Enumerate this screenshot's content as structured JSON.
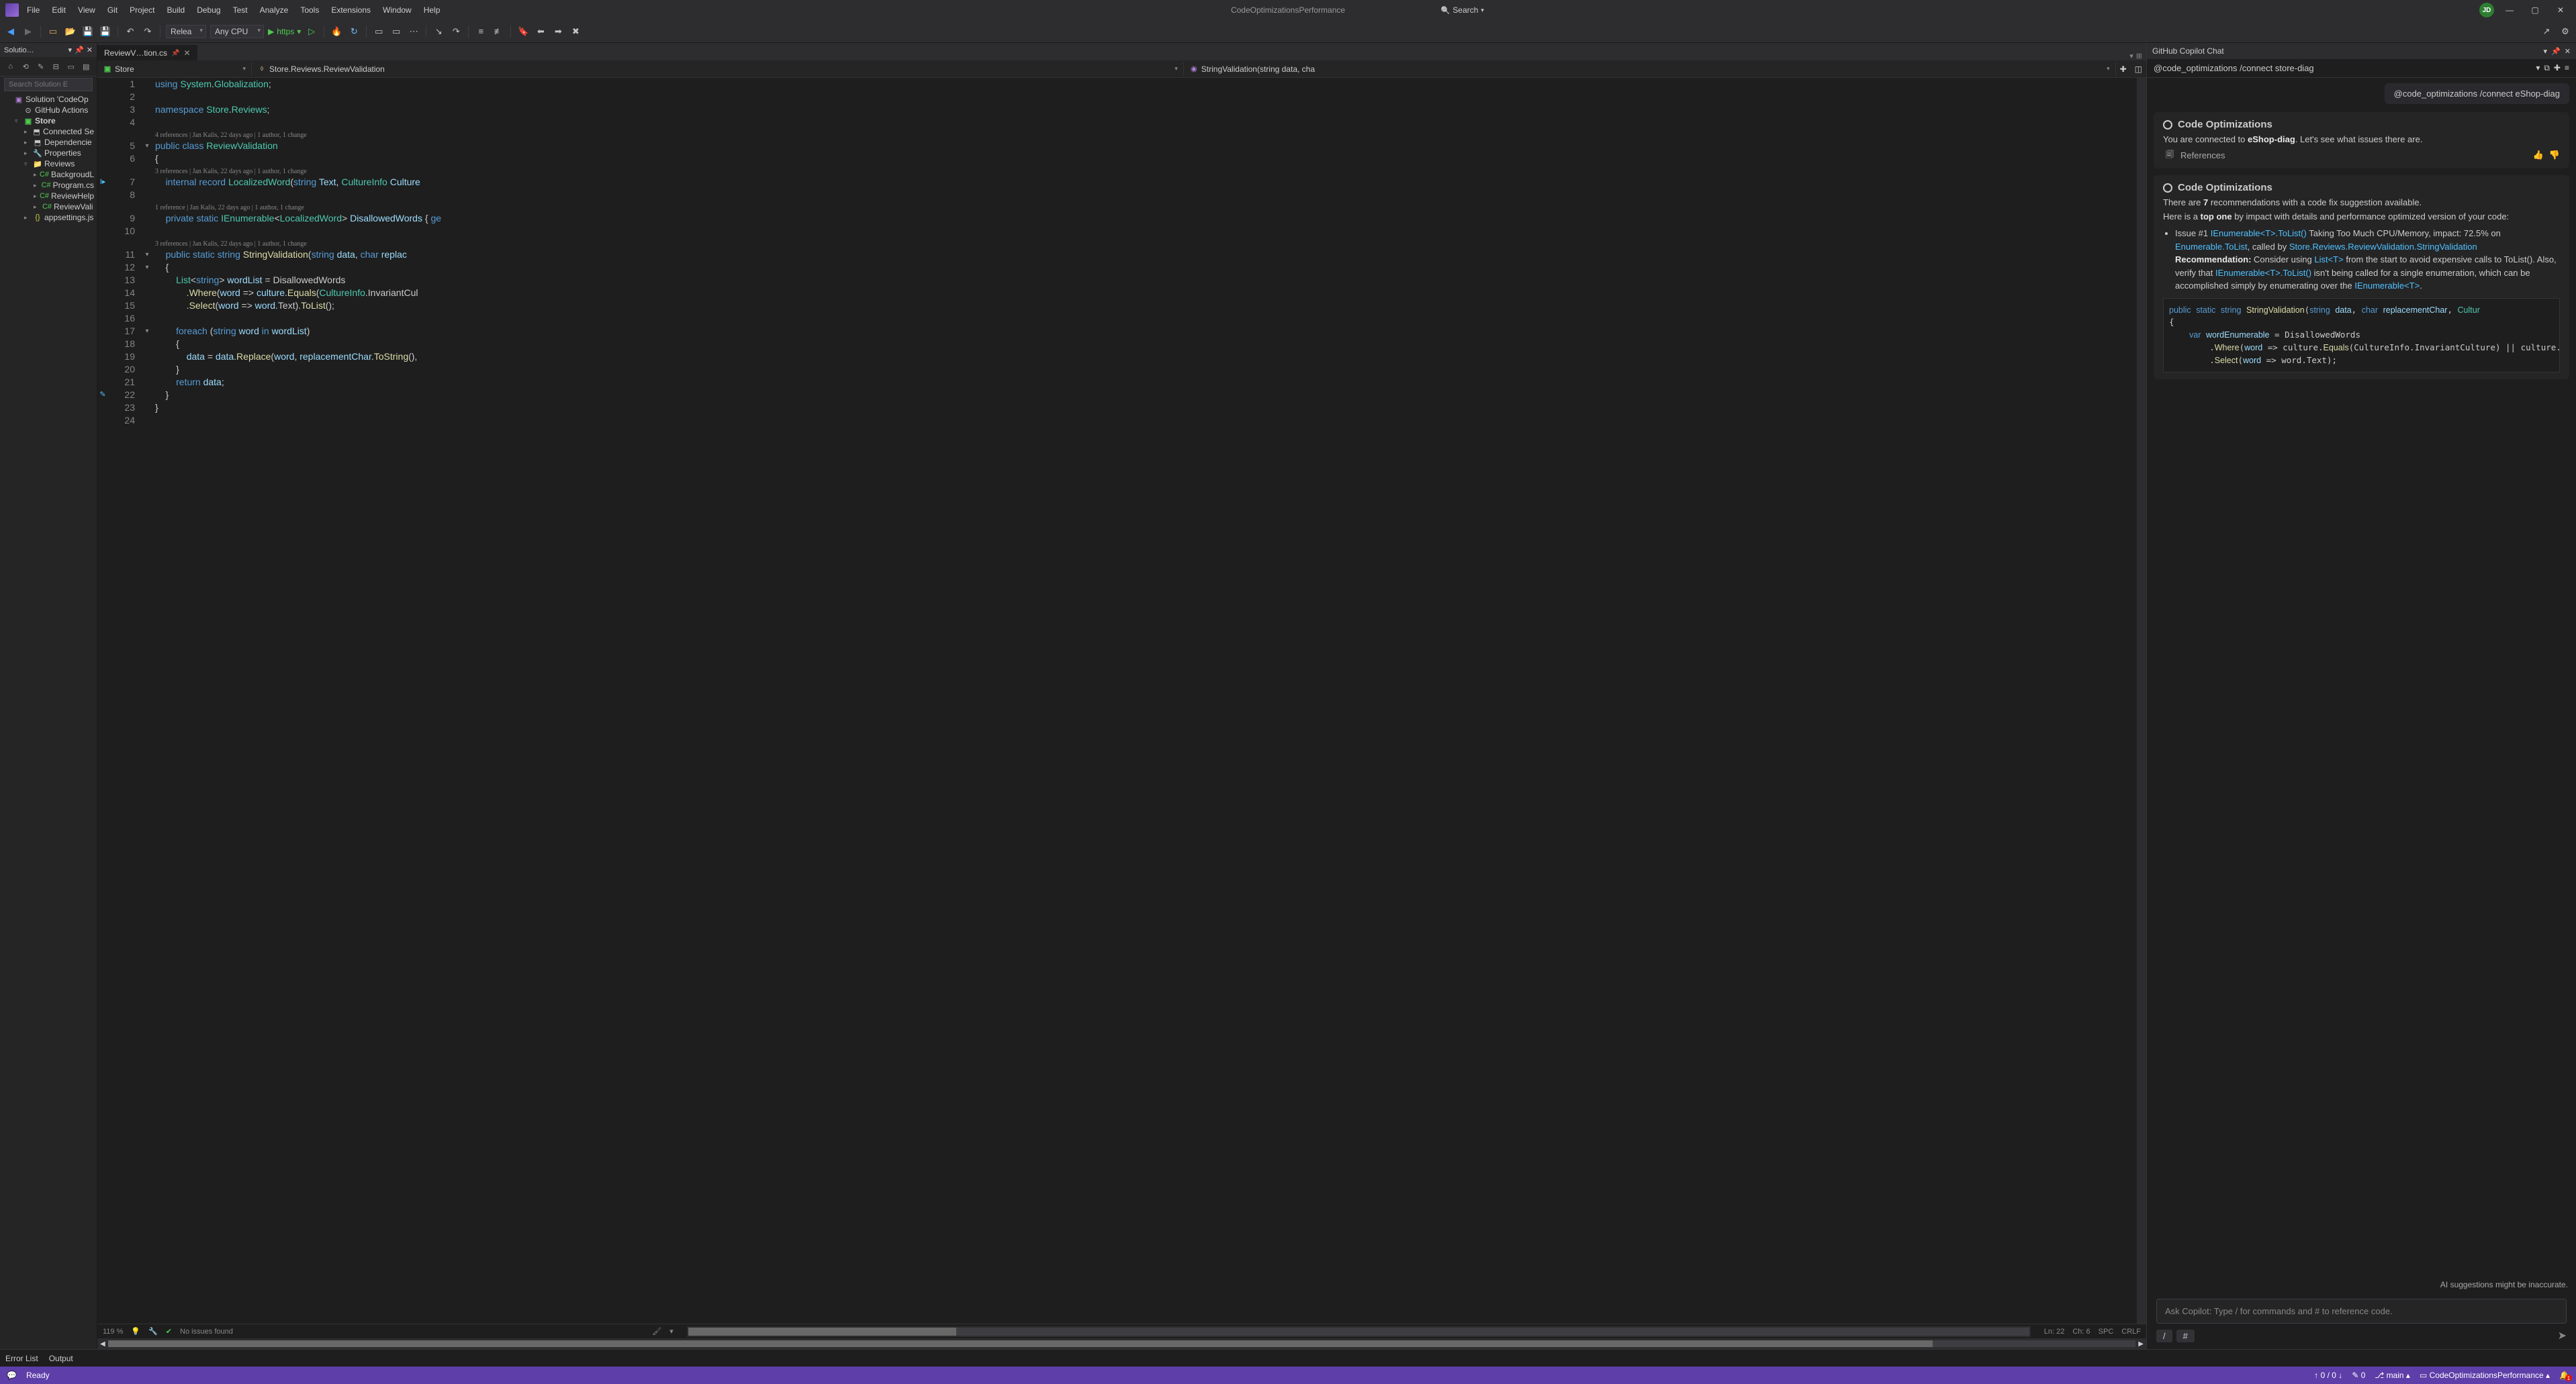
{
  "titlebar": {
    "menus": [
      "File",
      "Edit",
      "View",
      "Git",
      "Project",
      "Build",
      "Debug",
      "Test",
      "Analyze",
      "Tools",
      "Extensions",
      "Window",
      "Help"
    ],
    "search_label": "Search",
    "title": "CodeOptimizationsPerformance",
    "avatar": "JD"
  },
  "toolbar": {
    "config": "Relea",
    "platform": "Any CPU",
    "run": "https"
  },
  "solution": {
    "panel_title": "Solutio…",
    "search_placeholder": "Search Solution E",
    "nodes": [
      {
        "lvl": 1,
        "tw": "",
        "icon": "sln",
        "label": "Solution 'CodeOp"
      },
      {
        "lvl": 2,
        "tw": "",
        "icon": "gh",
        "label": "GitHub Actions"
      },
      {
        "lvl": 2,
        "tw": "▿",
        "icon": "proj",
        "label": "Store",
        "bold": true
      },
      {
        "lvl": 3,
        "tw": "▸",
        "icon": "dep",
        "label": "Connected Se"
      },
      {
        "lvl": 3,
        "tw": "▸",
        "icon": "dep",
        "label": "Dependencie"
      },
      {
        "lvl": 3,
        "tw": "▸",
        "icon": "wrench",
        "label": "Properties"
      },
      {
        "lvl": 3,
        "tw": "▿",
        "icon": "folder",
        "label": "Reviews"
      },
      {
        "lvl": 4,
        "tw": "▸",
        "icon": "cs",
        "label": "BackgroudL"
      },
      {
        "lvl": 4,
        "tw": "▸",
        "icon": "cs",
        "label": "Program.cs"
      },
      {
        "lvl": 4,
        "tw": "▸",
        "icon": "cs",
        "label": "ReviewHelp"
      },
      {
        "lvl": 4,
        "tw": "▸",
        "icon": "cs",
        "label": "ReviewVali"
      },
      {
        "lvl": 3,
        "tw": "▸",
        "icon": "json",
        "label": "appsettings.js"
      }
    ]
  },
  "editor": {
    "tab_name": "ReviewV…tion.cs",
    "nav1": "Store",
    "nav2": "Store.Reviews.ReviewValidation",
    "nav3": "StringValidation(string data, cha",
    "zoom": "119 %",
    "issues": "No issues found",
    "pos": "Ln: 22",
    "ch": "Ch: 6",
    "spc": "SPC",
    "crlf": "CRLF",
    "codelens1": "4 references | Jan Kalis, 22 days ago | 1 author, 1 change",
    "codelens2": "3 references | Jan Kalis, 22 days ago | 1 author, 1 change",
    "codelens3": "1 reference | Jan Kalis, 22 days ago | 1 author, 1 change",
    "codelens4": "3 references | Jan Kalis, 22 days ago | 1 author, 1 change"
  },
  "copilot": {
    "panel_title": "GitHub Copilot Chat",
    "cmd_text": "@code_optimizations /connect store-diag",
    "pill": "@code_optimizations /connect eShop-diag",
    "block1_title": "Code Optimizations",
    "block1_body_pre": "You are connected to ",
    "block1_body_bold": "eShop-diag",
    "block1_body_post": ". Let's see what issues there are.",
    "references": "References",
    "block2_title": "Code Optimizations",
    "block2_line1_pre": "There are ",
    "block2_line1_num": "7",
    "block2_line1_post": " recommendations with a code fix suggestion available.",
    "block2_line2_pre": "Here is a ",
    "block2_line2_bold": "top one",
    "block2_line2_post": " by impact with details and performance optimized version of your code:",
    "issue_label": "Issue #1 ",
    "issue_api": "IEnumerable<T>.ToList()",
    "issue_tail": " Taking Too Much CPU/Memory, impact: 72.5% on ",
    "issue_enum": "Enumerable.ToList",
    "issue_called": ", called by ",
    "issue_loc": "Store.Reviews.ReviewValidation.StringValidation",
    "rec_label": "Recommendation:",
    "rec_text1": " Consider using ",
    "rec_api1": "List<T>",
    "rec_text2": " from the start to avoid expensive calls to ToList(). Also, verify that ",
    "rec_api2": "IEnumerable<T>.ToList()",
    "rec_text3": " isn't being called for a single enumeration, which can be accomplished simply by enumerating over the ",
    "rec_api3": "IEnumerable<T>",
    "rec_text4": ".",
    "disclaimer": "AI suggestions might be inaccurate.",
    "input_placeholder": "Ask Copilot: Type / for commands and # to reference code.",
    "chip1": "/",
    "chip2": "#"
  },
  "bottom_tabs": [
    "Error List",
    "Output"
  ],
  "statusbar": {
    "ready": "Ready",
    "updown": "↑ 0 / 0 ↓",
    "reps": "0",
    "branch": "main",
    "proj": "CodeOptimizationsPerformance"
  }
}
